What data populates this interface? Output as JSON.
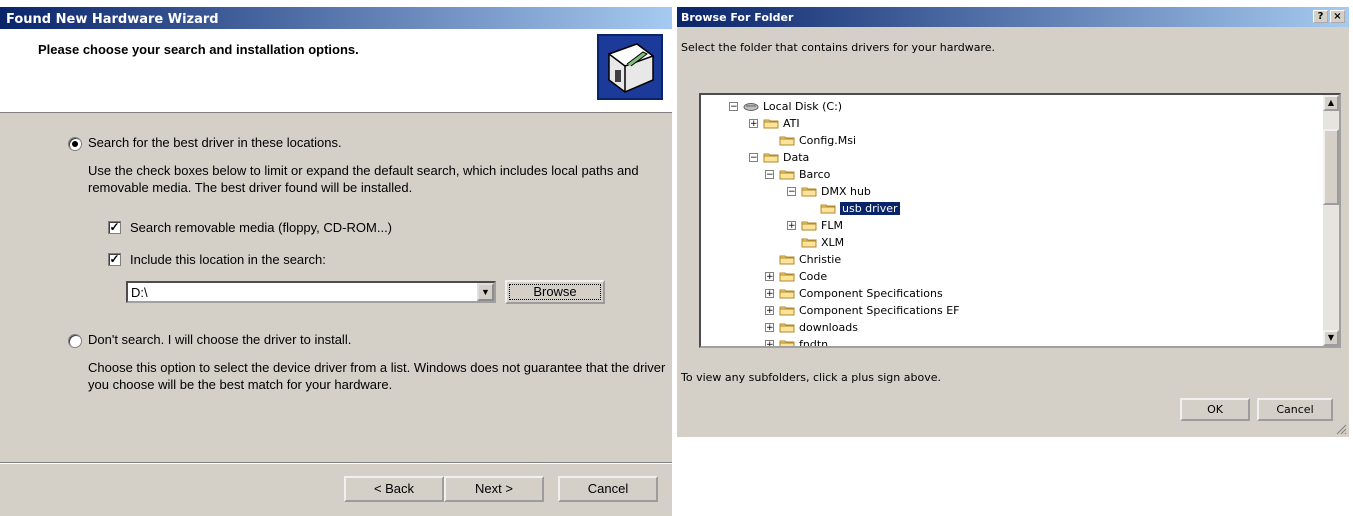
{
  "wizard": {
    "title": "Found New Hardware Wizard",
    "heading": "Please choose your search and installation options.",
    "icon": "hardware-wizard-icon",
    "option_search_label": "Search for the best driver in these locations.",
    "option_search_desc": "Use the check boxes below to limit or expand the default search, which includes local paths and removable media. The best driver found will be installed.",
    "check_removable_label": "Search removable media (floppy, CD-ROM...)",
    "check_location_label": "Include this location in the search:",
    "location_value": "D:\\",
    "browse_label": "Browse",
    "option_dont_search_label": "Don't search. I will choose the driver to install.",
    "option_dont_search_desc": "Choose this option to select the device driver from a list.  Windows does not guarantee that the driver you choose will be the best match for your hardware.",
    "back_label": "< Back",
    "next_label": "Next >",
    "cancel_label": "Cancel"
  },
  "browse": {
    "title": "Browse For Folder",
    "help_btn": "?",
    "close_btn": "×",
    "instruction": "Select the folder that contains drivers for your hardware.",
    "tree": [
      {
        "label": "Local Disk (C:)",
        "expander": "−",
        "kind": "drive"
      },
      {
        "label": "ATI",
        "expander": "+",
        "kind": "folder"
      },
      {
        "label": "Config.Msi",
        "expander": "",
        "kind": "folder"
      },
      {
        "label": "Data",
        "expander": "−",
        "kind": "folder"
      },
      {
        "label": "Barco",
        "expander": "−",
        "kind": "folder"
      },
      {
        "label": "DMX hub",
        "expander": "−",
        "kind": "folder"
      },
      {
        "label": "usb driver",
        "expander": "",
        "kind": "folder",
        "selected": true
      },
      {
        "label": "FLM",
        "expander": "+",
        "kind": "folder"
      },
      {
        "label": "XLM",
        "expander": "",
        "kind": "folder"
      },
      {
        "label": "Christie",
        "expander": "",
        "kind": "folder"
      },
      {
        "label": "Code",
        "expander": "+",
        "kind": "folder"
      },
      {
        "label": "Component Specifications",
        "expander": "+",
        "kind": "folder"
      },
      {
        "label": "Component Specifications EF",
        "expander": "+",
        "kind": "folder"
      },
      {
        "label": "downloads",
        "expander": "+",
        "kind": "folder"
      },
      {
        "label": "fndtn",
        "expander": "+",
        "kind": "folder"
      }
    ],
    "hint": "To view any subfolders, click a plus sign above.",
    "ok_label": "OK",
    "cancel_label": "Cancel"
  },
  "colors": {
    "title_start": "#0a246a",
    "title_end": "#a6caf0",
    "face": "#d4d0c8",
    "selection": "#0a246a"
  }
}
